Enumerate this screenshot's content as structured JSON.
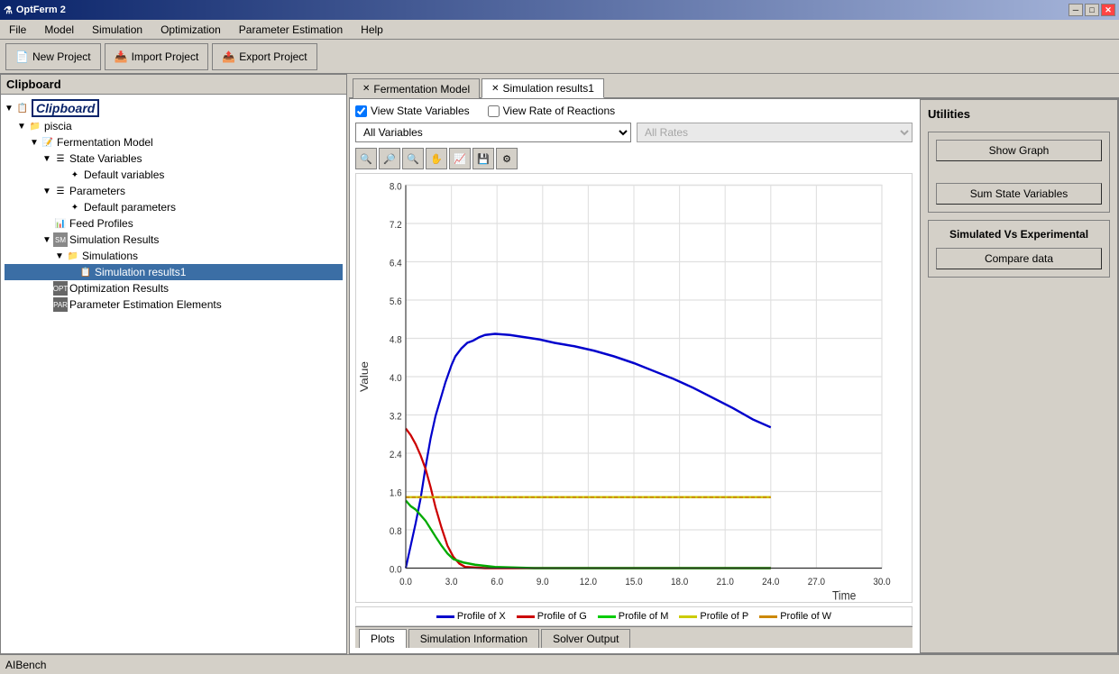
{
  "app": {
    "title": "OptFerm 2",
    "title_icon": "⚗"
  },
  "titlebar_controls": [
    "─",
    "□",
    "✕"
  ],
  "menu": {
    "items": [
      "File",
      "Model",
      "Simulation",
      "Optimization",
      "Parameter Estimation",
      "Help"
    ]
  },
  "toolbar": {
    "buttons": [
      {
        "label": "New Project",
        "icon": "📄"
      },
      {
        "label": "Import Project",
        "icon": "📥"
      },
      {
        "label": "Export Project",
        "icon": "📤"
      }
    ]
  },
  "sidebar": {
    "title": "Clipboard",
    "tree": [
      {
        "label": "Clipboard",
        "type": "root",
        "indent": 0
      },
      {
        "label": "piscia",
        "type": "folder",
        "indent": 1
      },
      {
        "label": "Fermentation Model",
        "type": "model",
        "indent": 2
      },
      {
        "label": "State Variables",
        "type": "list",
        "indent": 3
      },
      {
        "label": "Default variables",
        "type": "item",
        "indent": 4
      },
      {
        "label": "Parameters",
        "type": "list",
        "indent": 3
      },
      {
        "label": "Default parameters",
        "type": "item",
        "indent": 4
      },
      {
        "label": "Feed Profiles",
        "type": "item",
        "indent": 3
      },
      {
        "label": "Simulation Results",
        "type": "sm",
        "indent": 3
      },
      {
        "label": "Simulations",
        "type": "folder",
        "indent": 4
      },
      {
        "label": "Simulation results1",
        "type": "selected",
        "indent": 5
      },
      {
        "label": "Optimization Results",
        "type": "opt",
        "indent": 3
      },
      {
        "label": "Parameter Estimation Elements",
        "type": "par",
        "indent": 3
      }
    ]
  },
  "tabs": [
    {
      "label": "Fermentation Model",
      "active": false
    },
    {
      "label": "Simulation results1",
      "active": true
    }
  ],
  "view_options": {
    "view_state_variables_label": "View State Variables",
    "view_state_variables_checked": true,
    "view_rate_label": "View Rate of Reactions",
    "view_rate_checked": false
  },
  "dropdowns": {
    "variables": {
      "value": "All Variables",
      "options": [
        "All Variables"
      ]
    },
    "rates": {
      "value": "All Rates",
      "options": [
        "All Rates"
      ],
      "disabled": true
    }
  },
  "chart": {
    "x_label": "Time",
    "y_label": "Value",
    "y_max": 8.0,
    "y_ticks": [
      0.0,
      0.8,
      1.6,
      2.4,
      3.2,
      4.0,
      4.8,
      5.6,
      6.4,
      7.2,
      8.0
    ],
    "x_ticks": [
      0.0,
      3.0,
      6.0,
      9.0,
      12.0,
      15.0,
      18.0,
      21.0,
      24.0,
      27.0,
      30.0
    ]
  },
  "legend": [
    {
      "label": "Profile of X",
      "color": "#0000cc"
    },
    {
      "label": "Profile of G",
      "color": "#cc0000"
    },
    {
      "label": "Profile of M",
      "color": "#00cc00"
    },
    {
      "label": "Profile of P",
      "color": "#cccc00"
    },
    {
      "label": "Profile of W",
      "color": "#cc8800"
    }
  ],
  "bottom_tabs": [
    {
      "label": "Plots",
      "active": true
    },
    {
      "label": "Simulation Information",
      "active": false
    },
    {
      "label": "Solver Output",
      "active": false
    }
  ],
  "utilities": {
    "title": "Utilities",
    "sections": [
      {
        "button": "Show Graph",
        "sub_label": "Sum State Variables",
        "sub_button": "Sum State Variables"
      },
      {
        "label": "Simulated Vs Experimental",
        "button": "Compare data"
      }
    ]
  },
  "status_bar": {
    "text": "AIBench"
  }
}
